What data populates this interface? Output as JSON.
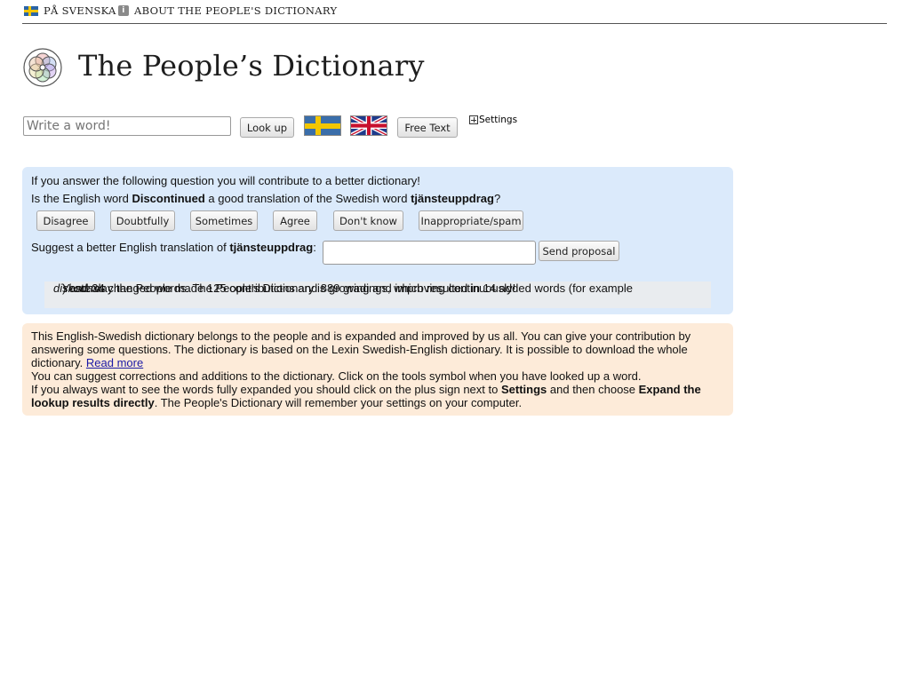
{
  "topnav": {
    "swedish_label": "PÅ SVENSKA",
    "about_label": "ABOUT THE PEOPLE'S DICTIONARY"
  },
  "header": {
    "title": "The People’s Dictionary"
  },
  "search": {
    "placeholder": "Write a word!",
    "lookup_label": "Look up",
    "free_text_label": "Free Text",
    "settings_label": "Settings"
  },
  "question": {
    "intro": "If you answer the following question you will contribute to a better dictionary!",
    "q_prefix": "Is the English word ",
    "english_word": "Discontinued",
    "q_mid": " a good translation of the Swedish word ",
    "swedish_word": "tjänsteuppdrag",
    "q_suffix": "?",
    "grades": [
      "Disagree",
      "Doubtfully",
      "Sometimes",
      "Agree",
      "Don't know",
      "Inappropriate/spam"
    ],
    "suggest_prefix": "Suggest a better English translation of ",
    "suggest_word": "tjänsteuppdrag",
    "suggest_suffix": ":",
    "send_label": "Send proposal"
  },
  "stats": {
    "part1": "Yesterday the People made 125 contributions and 889 gradings, which resulted in 14 added words (for example ",
    "example_word": "diskodans",
    "part2": ") and 34 changed words. The People's Dictionary is growing and improving continuously!"
  },
  "info": {
    "p1": "This English-Swedish dictionary belongs to the people and is expanded and improved by us all. You can give your contribution by answering some questions. The dictionary is based on the Lexin Swedish-English dictionary. It is possible to download the whole dictionary. ",
    "read_more": "Read more",
    "p2": "You can suggest corrections and additions to the dictionary. Click on the tools symbol when you have looked up a word.",
    "p3_prefix": "If you always want to see the words fully expanded you should click on the plus sign next to ",
    "p3_settings": "Settings",
    "p3_mid": " and then choose ",
    "p3_expand": "Expand the lookup results directly",
    "p3_suffix": ". The People's Dictionary will remember your settings on your computer."
  }
}
